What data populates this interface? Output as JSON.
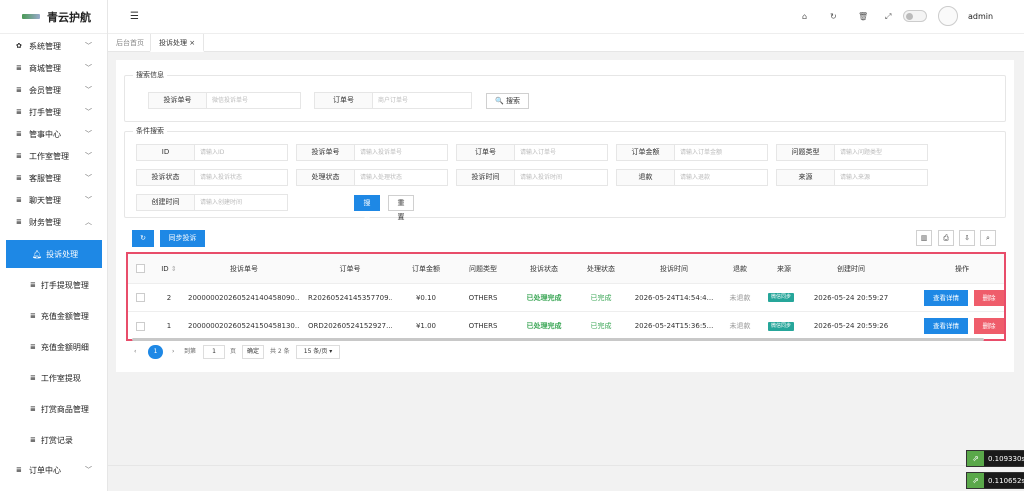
{
  "app": {
    "title": "青云护航",
    "user": "admin"
  },
  "sidebar": {
    "items": [
      {
        "label": "系统管理",
        "icon": "gear-icon",
        "glyph": "✿"
      },
      {
        "label": "商城管理",
        "icon": "list-icon",
        "glyph": "≣"
      },
      {
        "label": "会员管理",
        "icon": "list-icon",
        "glyph": "≣"
      },
      {
        "label": "打手管理",
        "icon": "list-icon",
        "glyph": "≣"
      },
      {
        "label": "管事中心",
        "icon": "list-icon",
        "glyph": "≣"
      },
      {
        "label": "工作室管理",
        "icon": "list-icon",
        "glyph": "≣"
      },
      {
        "label": "客服管理",
        "icon": "list-icon",
        "glyph": "≣"
      },
      {
        "label": "聊天管理",
        "icon": "list-icon",
        "glyph": "≣"
      },
      {
        "label": "财务管理",
        "icon": "list-icon",
        "glyph": "≣"
      }
    ],
    "finance_sub": [
      {
        "label": "投诉处理",
        "active": true
      },
      {
        "label": "打手提现管理"
      },
      {
        "label": "充值金额管理"
      },
      {
        "label": "充值金额明细"
      },
      {
        "label": "工作室提现"
      },
      {
        "label": "打赏商品管理"
      },
      {
        "label": "打赏记录"
      }
    ],
    "last": {
      "label": "订单中心"
    }
  },
  "tabs": [
    {
      "label": "后台首页"
    },
    {
      "label": "投诉处理 ×"
    }
  ],
  "search_info": {
    "legend": "搜索信息",
    "complaint_no": {
      "label": "投诉单号",
      "placeholder": "微信投诉单号"
    },
    "order_no": {
      "label": "订单号",
      "placeholder": "商户订单号"
    },
    "search_button": "🔍 搜索"
  },
  "condition": {
    "legend": "条件搜索",
    "fields": [
      {
        "label": "ID",
        "placeholder": "请输入ID"
      },
      {
        "label": "投诉单号",
        "placeholder": "请输入投诉单号"
      },
      {
        "label": "订单号",
        "placeholder": "请输入订单号"
      },
      {
        "label": "订单金额",
        "placeholder": "请输入订单金额"
      },
      {
        "label": "问题类型",
        "placeholder": "请输入问题类型"
      },
      {
        "label": "投诉状态",
        "placeholder": "请输入投诉状态"
      },
      {
        "label": "处理状态",
        "placeholder": "请输入处理状态"
      },
      {
        "label": "投诉时间",
        "placeholder": "请输入投诉时间"
      },
      {
        "label": "退款",
        "placeholder": "请输入退款"
      },
      {
        "label": "来源",
        "placeholder": "请输入来源"
      },
      {
        "label": "创建时间",
        "placeholder": "请输入创建时间"
      }
    ],
    "search_button": "搜索",
    "reset_button": "重置"
  },
  "toolbar": {
    "refresh_glyph": "↻",
    "sync_button": "同步投诉"
  },
  "table": {
    "headers": [
      "ID",
      "投诉单号",
      "订单号",
      "订单金额",
      "问题类型",
      "投诉状态",
      "处理状态",
      "投诉时间",
      "退款",
      "来源",
      "创建时间",
      "操作"
    ],
    "sort_glyph": "⇕",
    "rows": [
      {
        "id": "2",
        "complaint_no": "200000020260524140458090...",
        "order_no": "R20260524145357709...",
        "amount": "¥0.10",
        "type": "OTHERS",
        "complaint_status": "已处理完成",
        "process_status": "已完成",
        "complaint_time": "2026-05-24T14:54:4...",
        "refund": "未退款",
        "source": "微信同步",
        "created": "2026-05-24 20:59:27"
      },
      {
        "id": "1",
        "complaint_no": "200000020260524150458130...",
        "order_no": "ORD20260524152927...",
        "amount": "¥1.00",
        "type": "OTHERS",
        "complaint_status": "已处理完成",
        "process_status": "已完成",
        "complaint_time": "2026-05-24T15:36:5...",
        "refund": "未退款",
        "source": "微信同步",
        "created": "2026-05-24 20:59:26"
      }
    ],
    "view_button": "查看详情",
    "delete_button": "删除"
  },
  "pager": {
    "current": "1",
    "goto_label": "到第",
    "goto_value": "1",
    "page_unit": "页",
    "confirm": "确定",
    "total": "共 2 条",
    "page_size": "15 条/页 ▾",
    "prev": "‹",
    "next": "›"
  },
  "perf": [
    "0.109330s",
    "0.110652s"
  ]
}
